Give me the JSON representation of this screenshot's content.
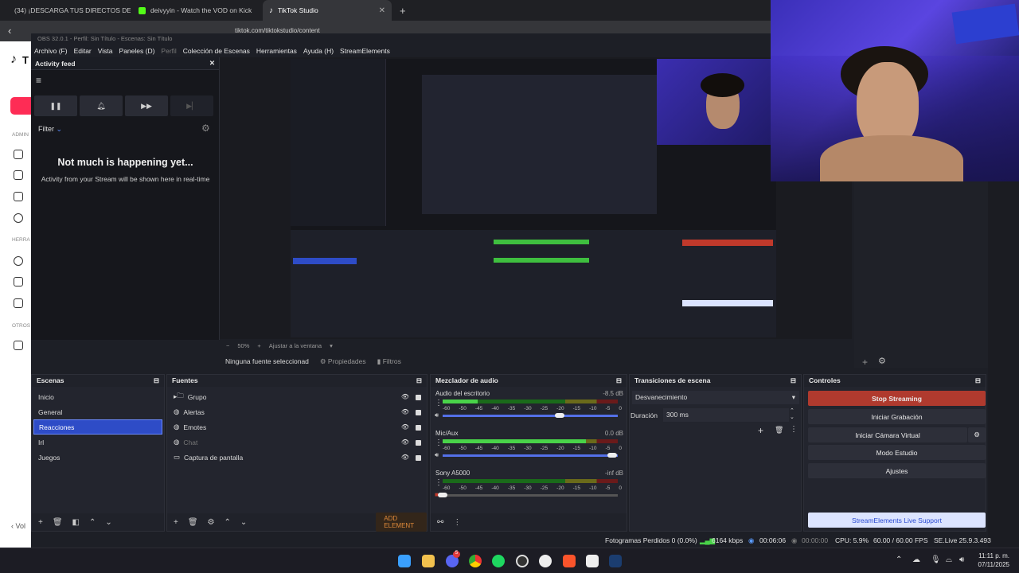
{
  "browser": {
    "tabs": [
      {
        "label": "(34) ¡DESCARGA TUS DIRECTOS DE K",
        "color": "#e02828"
      },
      {
        "label": "deivyyin - Watch the VOD on Kick",
        "color": "#53fc18"
      },
      {
        "label": "TikTok Studio",
        "color": "#ffffff"
      }
    ],
    "url": "tiktok.com/tiktokstudio/content",
    "new_tab_label": "+"
  },
  "tiktok": {
    "logo": "T",
    "sections": [
      "ADMIN",
      "HERRA",
      "OTROS"
    ],
    "back_label": "‹ Vol"
  },
  "obs": {
    "title": "OBS 32.0.1 - Perfil: Sin Título - Escenas: Sin Título",
    "menu": [
      "Archivo (F)",
      "Editar",
      "Vista",
      "Paneles (D)",
      "Perfil",
      "Colección de Escenas",
      "Herramientas",
      "Ayuda (H)",
      "StreamElements"
    ],
    "activity": {
      "title": "Activity feed",
      "filter": "Filter",
      "empty_title": "Not much is happening yet...",
      "empty_text": "Activity from your Stream will be shown here in real-time"
    },
    "preview": {
      "zoom": "50%",
      "fit": "Ajustar a la ventana",
      "no_source": "Ninguna fuente seleccionad",
      "properties": "Propiedades",
      "filters": "Filtros"
    },
    "scenes": {
      "title": "Escenas",
      "items": [
        "Inicio",
        "General",
        "Reacciones",
        "Irl",
        "Juegos"
      ],
      "selected": "Reacciones"
    },
    "sources": {
      "title": "Fuentes",
      "items": [
        {
          "label": "Grupo",
          "icon": "folder-icon"
        },
        {
          "label": "Alertas",
          "icon": "globe-icon"
        },
        {
          "label": "Emotes",
          "icon": "globe-icon"
        },
        {
          "label": "Chat",
          "icon": "globe-icon"
        },
        {
          "label": "Captura de pantalla",
          "icon": "monitor-icon"
        }
      ],
      "add_element": "ADD ELEMENT"
    },
    "mixer": {
      "title": "Mezclador de audio",
      "channels": [
        {
          "name": "Audio del escritorio",
          "db": "-8.5 dB",
          "level": 0.2,
          "volume": 0.67
        },
        {
          "name": "Mic/Aux",
          "db": "0.0 dB",
          "level": 0.82,
          "volume": 0.97
        },
        {
          "name": "Sony A5000",
          "db": "-inf dB",
          "level": 0.0,
          "volume": 0.0
        }
      ],
      "scale": [
        "-60",
        "-50",
        "-45",
        "-40",
        "-35",
        "-30",
        "-25",
        "-20",
        "-15",
        "-10",
        "-5",
        "0"
      ]
    },
    "transitions": {
      "title": "Transiciones de escena",
      "selected": "Desvanecimiento",
      "duration_label": "Duración",
      "duration_value": "300 ms"
    },
    "controls": {
      "title": "Controles",
      "buttons": [
        "Stop Streaming",
        "Iniciar Grabación",
        "Iniciar Cámara Virtual",
        "Modo Estudio",
        "Ajustes"
      ],
      "support": "StreamElements Live Support"
    },
    "status": {
      "dropped": "Fotogramas Perdidos 0 (0.0%)",
      "bitrate": "6164 kbps",
      "live_time": "00:06:06",
      "rec_time": "00:00:00",
      "cpu": "CPU: 5.9%",
      "fps": "60.00 / 60.00 FPS",
      "version": "SE.Live 25.9.3.493"
    }
  },
  "taskbar": {
    "time": "11:11 p. m.",
    "date": "07/11/2025",
    "badge": "5"
  },
  "colors": {
    "stop_streaming": "#c0392b",
    "selected_scene": "#2e4cc7",
    "support_button": "#dce4ff"
  }
}
